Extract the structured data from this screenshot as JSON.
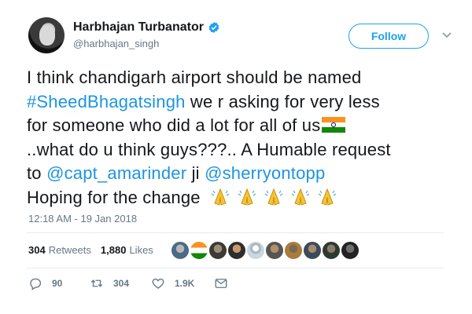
{
  "author": {
    "display_name": "Harbhajan Turbanator",
    "handle": "@harbhajan_singh",
    "verified": true
  },
  "follow_button": {
    "label": "Follow"
  },
  "tweet": {
    "line1": "I think chandigarh airport should be named",
    "hashtag": "#SheedBhagatsingh",
    "line2_rest": " we r asking for very less",
    "line3": "for someone who did a lot for all of us",
    "line4": "..what do u think guys???.. A Humable request",
    "line5_pre": "to ",
    "mention1": "@capt_amarinder",
    "line5_mid": " ji ",
    "mention2": "@sherryontopp",
    "line6": "Hoping for the change",
    "emoji": [
      "flag-india-icon",
      "folded-hands-icon"
    ]
  },
  "timestamp": "12:18 AM - 19 Jan 2018",
  "stats": {
    "retweets_count": "304",
    "retweets_label": "Retweets",
    "likes_count": "1,880",
    "likes_label": "Likes"
  },
  "likers_count_shown": 10,
  "actions": {
    "reply_count": "90",
    "retweet_count": "304",
    "like_count": "1.9K"
  },
  "colors": {
    "accent": "#1da1f2",
    "link": "#1b95e0",
    "muted": "#657786",
    "text": "#14171a"
  }
}
